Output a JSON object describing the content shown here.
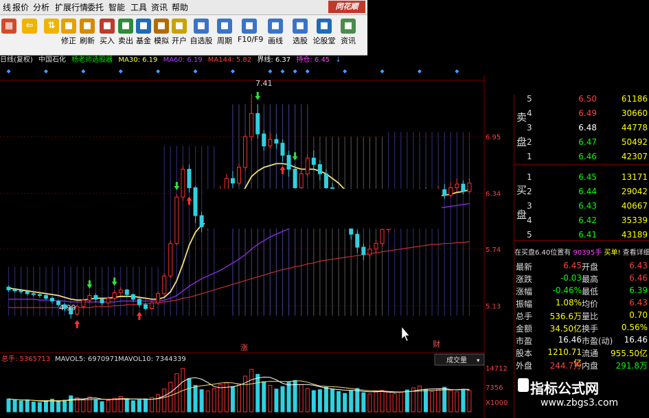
{
  "menu": {
    "items": [
      "线",
      "报价",
      "分析",
      "扩展行情",
      "委托",
      "智能",
      "工具",
      "资讯",
      "帮助"
    ],
    "brand": "同花顺"
  },
  "toolbar": {
    "buttons": [
      {
        "label": "修正",
        "icon": "refresh-icon",
        "color": "#e6a100"
      },
      {
        "label": "刷新",
        "icon": "clock-icon",
        "color": "#d68a00"
      },
      {
        "label": "买入",
        "icon": "buy-icon",
        "color": "#c0392b"
      },
      {
        "label": "卖出",
        "icon": "sell-icon",
        "color": "#2e8b3a"
      },
      {
        "label": "基金",
        "icon": "fund-icon",
        "color": "#1e6bb8"
      },
      {
        "label": "模拟",
        "icon": "hammer-icon",
        "color": "#b36b00"
      },
      {
        "label": "开户",
        "icon": "lock-icon",
        "color": "#c8a200"
      },
      {
        "label": "自选股",
        "icon": "star-icon",
        "color": "#3a74c8"
      },
      {
        "label": "周期",
        "icon": "clock-icon",
        "color": "#3a74c8"
      },
      {
        "label": "F10/F9",
        "icon": "f10-icon",
        "color": "#3a74c8"
      },
      {
        "label": "画线",
        "icon": "pen-icon",
        "color": "#3a74c8"
      },
      {
        "label": "选股",
        "icon": "screen-icon",
        "color": "#3a74c8"
      },
      {
        "label": "论股堂",
        "icon": "chat-icon",
        "color": "#1e6bb8"
      },
      {
        "label": "资讯",
        "icon": "news-icon",
        "color": "#4a8c4a"
      }
    ]
  },
  "infobar": {
    "period": "日线(复权)",
    "stock": "中国石化",
    "indicator": "杨老师选股器",
    "ma30": "MA30: 6.19",
    "ma60": "MA60: 6.19",
    "ma144": "MA144: 5.82",
    "boundary": "界线: 6.37",
    "position": "持仓: 6.45"
  },
  "chart_data": {
    "type": "candlestick",
    "price_axis": {
      "ticks": [
        "6.95",
        "6.34",
        "5.74",
        "5.13"
      ],
      "range": [
        4.8,
        7.55
      ]
    },
    "annotations": {
      "high": "7.41",
      "low": "4.99",
      "label_zhang": "涨",
      "label_cai": "财"
    },
    "volume_axis": {
      "ticks": [
        "14712",
        "7356",
        "X1000"
      ]
    },
    "volume_info": {
      "total": "总手: 5365713",
      "mavol5": "MAVOL5: 6970971",
      "mavol10": "MAVOL10: 7344339"
    },
    "volume_selector": "成交量",
    "candles": [
      {
        "o": 5.33,
        "c": 5.3,
        "h": 5.35,
        "l": 5.28
      },
      {
        "o": 5.3,
        "c": 5.29,
        "h": 5.32,
        "l": 5.27
      },
      {
        "o": 5.29,
        "c": 5.28,
        "h": 5.31,
        "l": 5.26
      },
      {
        "o": 5.28,
        "c": 5.26,
        "h": 5.3,
        "l": 5.24
      },
      {
        "o": 5.26,
        "c": 5.25,
        "h": 5.28,
        "l": 5.23
      },
      {
        "o": 5.25,
        "c": 5.24,
        "h": 5.27,
        "l": 5.22
      },
      {
        "o": 5.24,
        "c": 5.21,
        "h": 5.26,
        "l": 5.19
      },
      {
        "o": 5.21,
        "c": 5.18,
        "h": 5.23,
        "l": 5.15
      },
      {
        "o": 5.18,
        "c": 5.14,
        "h": 5.19,
        "l": 5.12
      },
      {
        "o": 5.14,
        "c": 5.1,
        "h": 5.16,
        "l": 5.07
      },
      {
        "o": 5.1,
        "c": 5.04,
        "h": 5.12,
        "l": 4.99
      },
      {
        "o": 5.04,
        "c": 5.12,
        "h": 5.14,
        "l": 5.02
      },
      {
        "o": 5.12,
        "c": 5.19,
        "h": 5.21,
        "l": 5.1
      },
      {
        "o": 5.19,
        "c": 5.24,
        "h": 5.27,
        "l": 5.16
      },
      {
        "o": 5.24,
        "c": 5.2,
        "h": 5.26,
        "l": 5.17
      },
      {
        "o": 5.2,
        "c": 5.16,
        "h": 5.22,
        "l": 5.13
      },
      {
        "o": 5.16,
        "c": 5.21,
        "h": 5.23,
        "l": 5.14
      },
      {
        "o": 5.21,
        "c": 5.27,
        "h": 5.3,
        "l": 5.19
      },
      {
        "o": 5.27,
        "c": 5.3,
        "h": 5.33,
        "l": 5.24
      },
      {
        "o": 5.3,
        "c": 5.25,
        "h": 5.31,
        "l": 5.22
      },
      {
        "o": 5.25,
        "c": 5.2,
        "h": 5.26,
        "l": 5.17
      },
      {
        "o": 5.2,
        "c": 5.14,
        "h": 5.22,
        "l": 5.11
      },
      {
        "o": 5.14,
        "c": 5.1,
        "h": 5.16,
        "l": 5.08
      },
      {
        "o": 5.1,
        "c": 5.16,
        "h": 5.18,
        "l": 5.09
      },
      {
        "o": 5.16,
        "c": 5.26,
        "h": 5.28,
        "l": 5.14
      },
      {
        "o": 5.26,
        "c": 5.45,
        "h": 5.48,
        "l": 5.24
      },
      {
        "o": 5.45,
        "c": 5.8,
        "h": 5.83,
        "l": 5.43
      },
      {
        "o": 5.8,
        "c": 6.3,
        "h": 6.33,
        "l": 5.78
      },
      {
        "o": 6.3,
        "c": 6.6,
        "h": 6.64,
        "l": 6.26
      },
      {
        "o": 6.6,
        "c": 6.4,
        "h": 6.65,
        "l": 6.35
      },
      {
        "o": 6.4,
        "c": 6.1,
        "h": 6.42,
        "l": 6.02
      },
      {
        "o": 6.1,
        "c": 5.98,
        "h": 6.14,
        "l": 5.92
      },
      {
        "o": 5.98,
        "c": 6.05,
        "h": 6.08,
        "l": 5.95
      },
      {
        "o": 6.05,
        "c": 6.2,
        "h": 6.24,
        "l": 6.02
      },
      {
        "o": 6.2,
        "c": 6.38,
        "h": 6.42,
        "l": 6.17
      },
      {
        "o": 6.38,
        "c": 6.5,
        "h": 6.55,
        "l": 6.33
      },
      {
        "o": 6.5,
        "c": 6.45,
        "h": 6.58,
        "l": 6.4
      },
      {
        "o": 6.45,
        "c": 6.62,
        "h": 6.66,
        "l": 6.42
      },
      {
        "o": 6.62,
        "c": 6.95,
        "h": 6.98,
        "l": 6.58
      },
      {
        "o": 6.95,
        "c": 7.2,
        "h": 7.41,
        "l": 6.9
      },
      {
        "o": 7.2,
        "c": 6.98,
        "h": 7.3,
        "l": 6.93
      },
      {
        "o": 6.98,
        "c": 6.85,
        "h": 7.02,
        "l": 6.8
      },
      {
        "o": 6.85,
        "c": 6.92,
        "h": 7.0,
        "l": 6.82
      },
      {
        "o": 6.92,
        "c": 6.88,
        "h": 6.98,
        "l": 6.82
      },
      {
        "o": 6.88,
        "c": 6.75,
        "h": 6.92,
        "l": 6.68
      },
      {
        "o": 6.75,
        "c": 6.6,
        "h": 6.8,
        "l": 6.52
      },
      {
        "o": 6.6,
        "c": 6.4,
        "h": 6.65,
        "l": 6.34
      },
      {
        "o": 6.4,
        "c": 6.55,
        "h": 6.6,
        "l": 6.36
      },
      {
        "o": 6.55,
        "c": 6.72,
        "h": 6.76,
        "l": 6.52
      },
      {
        "o": 6.72,
        "c": 6.65,
        "h": 6.8,
        "l": 6.6
      },
      {
        "o": 6.65,
        "c": 6.55,
        "h": 6.7,
        "l": 6.48
      },
      {
        "o": 6.55,
        "c": 6.4,
        "h": 6.6,
        "l": 6.35
      },
      {
        "o": 6.4,
        "c": 6.3,
        "h": 6.45,
        "l": 6.25
      },
      {
        "o": 6.3,
        "c": 6.2,
        "h": 6.34,
        "l": 6.12
      },
      {
        "o": 6.2,
        "c": 6.05,
        "h": 6.24,
        "l": 5.98
      },
      {
        "o": 6.05,
        "c": 5.9,
        "h": 6.1,
        "l": 5.84
      },
      {
        "o": 5.9,
        "c": 5.76,
        "h": 5.94,
        "l": 5.7
      },
      {
        "o": 5.76,
        "c": 5.68,
        "h": 5.8,
        "l": 5.62
      },
      {
        "o": 5.68,
        "c": 5.74,
        "h": 5.78,
        "l": 5.64
      },
      {
        "o": 5.74,
        "c": 5.8,
        "h": 5.84,
        "l": 5.7
      },
      {
        "o": 5.8,
        "c": 5.95,
        "h": 5.98,
        "l": 5.77
      },
      {
        "o": 5.95,
        "c": 6.1,
        "h": 6.14,
        "l": 5.92
      },
      {
        "o": 6.1,
        "c": 6.2,
        "h": 6.25,
        "l": 6.06
      },
      {
        "o": 6.2,
        "c": 6.28,
        "h": 6.33,
        "l": 6.15
      },
      {
        "o": 6.28,
        "c": 6.22,
        "h": 6.32,
        "l": 6.16
      },
      {
        "o": 6.22,
        "c": 6.3,
        "h": 6.35,
        "l": 6.18
      },
      {
        "o": 6.3,
        "c": 6.36,
        "h": 6.4,
        "l": 6.25
      },
      {
        "o": 6.36,
        "c": 6.3,
        "h": 6.4,
        "l": 6.26
      },
      {
        "o": 6.3,
        "c": 6.34,
        "h": 6.38,
        "l": 6.26
      },
      {
        "o": 6.34,
        "c": 6.38,
        "h": 6.42,
        "l": 6.28
      },
      {
        "o": 6.38,
        "c": 6.32,
        "h": 6.44,
        "l": 6.28
      },
      {
        "o": 6.32,
        "c": 6.4,
        "h": 6.46,
        "l": 6.3
      },
      {
        "o": 6.4,
        "c": 6.44,
        "h": 6.5,
        "l": 6.36
      },
      {
        "o": 6.44,
        "c": 6.36,
        "h": 6.48,
        "l": 6.33
      },
      {
        "o": 6.36,
        "c": 6.45,
        "h": 6.5,
        "l": 6.34
      }
    ],
    "ma_yellow": [
      5.32,
      5.31,
      5.3,
      5.29,
      5.28,
      5.27,
      5.26,
      5.25,
      5.24,
      5.22,
      5.2,
      5.19,
      5.19,
      5.2,
      5.21,
      5.21,
      5.21,
      5.22,
      5.23,
      5.23,
      5.23,
      5.22,
      5.21,
      5.2,
      5.2,
      5.22,
      5.28,
      5.4,
      5.58,
      5.78,
      5.92,
      6.0,
      6.03,
      6.06,
      6.1,
      6.15,
      6.22,
      6.3,
      6.4,
      6.52,
      6.58,
      6.62,
      6.64,
      6.66,
      6.66,
      6.65,
      6.62,
      6.6,
      6.6,
      6.6,
      6.58,
      6.55,
      6.5,
      6.45,
      6.38,
      6.3,
      6.22,
      6.15,
      6.1,
      6.08,
      6.08,
      6.1,
      6.13,
      6.17,
      6.2,
      6.23,
      6.26,
      6.28,
      6.29,
      6.31,
      6.32,
      6.33,
      6.35,
      6.36,
      6.38
    ],
    "ma_purple": [
      5.2,
      5.2,
      5.2,
      5.2,
      5.2,
      5.19,
      5.19,
      5.19,
      5.18,
      5.18,
      5.17,
      5.17,
      5.17,
      5.17,
      5.17,
      5.17,
      5.17,
      5.17,
      5.18,
      5.18,
      5.18,
      5.18,
      5.18,
      5.18,
      5.18,
      5.19,
      5.21,
      5.24,
      5.29,
      5.34,
      5.38,
      5.42,
      5.45,
      5.48,
      5.51,
      5.55,
      5.59,
      5.63,
      5.68,
      5.74,
      5.79,
      5.83,
      5.87,
      5.9,
      5.93,
      5.96,
      5.98,
      6.0,
      6.02,
      6.04,
      6.05,
      6.06,
      6.07,
      6.08,
      6.08,
      6.08,
      6.08,
      6.08,
      6.08,
      6.08,
      6.09,
      6.1,
      6.11,
      6.12,
      6.13,
      6.14,
      6.15,
      6.16,
      6.17,
      6.18,
      6.19,
      6.2,
      6.21,
      6.22,
      6.23
    ],
    "ma_red": [
      5.11,
      5.11,
      5.11,
      5.11,
      5.11,
      5.11,
      5.11,
      5.11,
      5.11,
      5.11,
      5.11,
      5.11,
      5.11,
      5.11,
      5.12,
      5.12,
      5.12,
      5.13,
      5.13,
      5.14,
      5.14,
      5.15,
      5.15,
      5.16,
      5.16,
      5.17,
      5.18,
      5.19,
      5.21,
      5.22,
      5.24,
      5.26,
      5.28,
      5.3,
      5.32,
      5.34,
      5.36,
      5.38,
      5.4,
      5.42,
      5.44,
      5.46,
      5.48,
      5.5,
      5.52,
      5.53,
      5.55,
      5.56,
      5.58,
      5.59,
      5.61,
      5.62,
      5.63,
      5.64,
      5.65,
      5.66,
      5.67,
      5.68,
      5.69,
      5.7,
      5.71,
      5.72,
      5.73,
      5.74,
      5.75,
      5.76,
      5.77,
      5.78,
      5.79,
      5.79,
      5.8,
      5.8,
      5.81,
      5.81,
      5.82
    ],
    "volume": [
      4.2,
      3.8,
      3.5,
      3.9,
      3.2,
      3.0,
      3.6,
      4.1,
      3.4,
      3.8,
      5.2,
      4.6,
      4.0,
      4.8,
      3.9,
      3.3,
      3.7,
      4.4,
      5.0,
      4.1,
      3.6,
      3.8,
      4.2,
      4.7,
      5.6,
      7.4,
      9.6,
      12.4,
      14.1,
      10.8,
      8.6,
      7.2,
      6.8,
      7.6,
      8.8,
      9.4,
      8.2,
      9.0,
      11.6,
      13.8,
      12.2,
      9.8,
      8.6,
      7.4,
      8.2,
      9.6,
      10.2,
      8.8,
      7.6,
      6.9,
      7.2,
      8.0,
      7.4,
      6.6,
      6.0,
      6.8,
      7.6,
      6.2,
      5.8,
      6.4,
      7.0,
      6.6,
      5.9,
      6.3,
      7.1,
      7.8,
      8.4,
      7.2,
      6.6,
      7.4,
      8.0,
      7.0,
      6.5,
      7.3,
      6.9
    ]
  },
  "order_book": {
    "sell_label": [
      "卖",
      "盘"
    ],
    "buy_label": [
      "买",
      "盘"
    ],
    "sells": [
      {
        "level": "5",
        "price": "6.50",
        "vol": "61186"
      },
      {
        "level": "4",
        "price": "6.49",
        "vol": "30660"
      },
      {
        "level": "3",
        "price": "6.48",
        "vol": "44778"
      },
      {
        "level": "2",
        "price": "6.47",
        "vol": "50492"
      },
      {
        "level": "1",
        "price": "6.46",
        "vol": "42307"
      }
    ],
    "buys": [
      {
        "level": "1",
        "price": "6.45",
        "vol": "13171"
      },
      {
        "level": "2",
        "price": "6.44",
        "vol": "29042"
      },
      {
        "level": "3",
        "price": "6.43",
        "vol": "40667"
      },
      {
        "level": "4",
        "price": "6.42",
        "vol": "35339"
      },
      {
        "level": "5",
        "price": "6.41",
        "vol": "43189"
      }
    ],
    "note": "在买盘6.40位置有",
    "note_vol": "90395手",
    "note_sign": "买单!",
    "note_link": "查看详细"
  },
  "stats": [
    {
      "l": "最新",
      "v": "6.45",
      "vc": "#ff4040",
      "l2": "开盘",
      "v2": "6.43",
      "v2c": "#ff4040"
    },
    {
      "l": "涨跌",
      "v": "-0.03",
      "vc": "#00ff00",
      "l2": "最高",
      "v2": "6.46",
      "v2c": "#ff4040"
    },
    {
      "l": "涨幅",
      "v": "-0.46%",
      "vc": "#00ff00",
      "l2": "最低",
      "v2": "6.39",
      "v2c": "#00ff00"
    },
    {
      "l": "振幅",
      "v": "1.08%",
      "vc": "#ffff00",
      "l2": "均价",
      "v2": "6.43",
      "v2c": "#ff4040"
    },
    {
      "l": "总手",
      "v": "536.6万",
      "vc": "#ffff00",
      "l2": "量比",
      "v2": "0.70",
      "v2c": "#ffff00"
    },
    {
      "l": "金额",
      "v": "34.50亿",
      "vc": "#ffff00",
      "l2": "换手",
      "v2": "0.56%",
      "v2c": "#ffff00"
    },
    {
      "l": "市盈",
      "v": "16.46",
      "vc": "#ffffff",
      "l2": "市盈(动)",
      "v2": "16.46",
      "v2c": "#ffffff"
    },
    {
      "l": "股本",
      "v": "1210.71亿",
      "vc": "#ffff00",
      "l2": "流通",
      "v2": "955.50亿",
      "v2c": "#ffff00"
    },
    {
      "l": "外盘",
      "v": "244.7万",
      "vc": "#ff4040",
      "l2": "内盘",
      "v2": "291.8万",
      "v2c": "#00ff00"
    }
  ],
  "watermark": {
    "title": "指标公式网",
    "url": "www.zbgs3.com"
  }
}
